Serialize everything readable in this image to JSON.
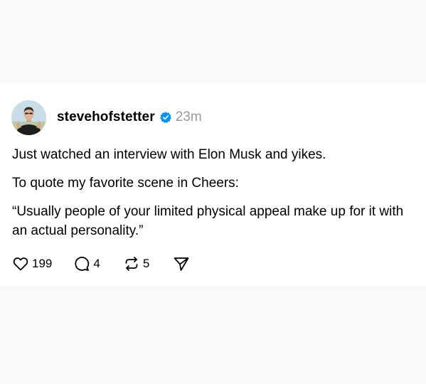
{
  "post": {
    "author": {
      "username": "stevehofstetter",
      "verified_icon": "verified-badge-icon",
      "avatar_icon": "profile-avatar"
    },
    "timestamp": "23m",
    "paragraphs": [
      "Just watched an interview with Elon Musk and yikes.",
      "To quote my favorite scene in Cheers:",
      "“Usually people of your limited physical appeal make up for it with an actual personality.”"
    ],
    "actions": {
      "like": {
        "icon": "heart-icon",
        "count": "199"
      },
      "reply": {
        "icon": "comment-icon",
        "count": "4"
      },
      "repost": {
        "icon": "repost-icon",
        "count": "5"
      },
      "share": {
        "icon": "send-icon"
      }
    }
  },
  "colors": {
    "page_background": "#f9f9f9",
    "card_background": "#ffffff",
    "verified_blue": "#0095f6",
    "timestamp_gray": "#999999"
  }
}
